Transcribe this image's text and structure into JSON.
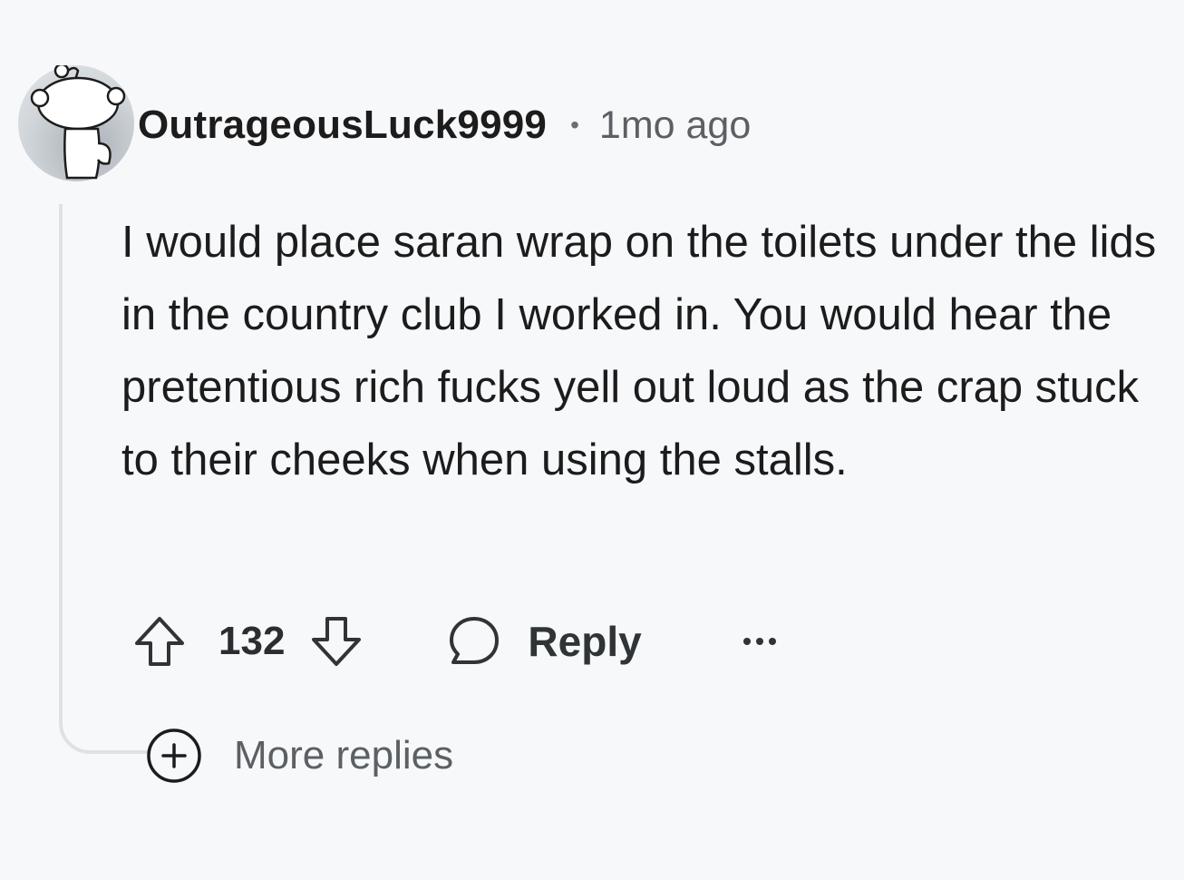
{
  "comment": {
    "username": "OutrageousLuck9999",
    "separator": "•",
    "timestamp": "1mo ago",
    "body": "I would place saran wrap on the toilets under the lids in the country club I worked in. You would hear the pretentious rich fucks yell out loud as the crap stuck to their cheeks when using the stalls.",
    "vote_count": "132",
    "reply_label": "Reply",
    "more_replies_label": "More replies"
  },
  "icons": {
    "avatar": "snoo-avatar-icon",
    "upvote": "arrow-up-icon",
    "downvote": "arrow-down-icon",
    "reply": "chat-bubble-icon",
    "more": "ellipsis-icon",
    "expand": "plus-circle-icon"
  },
  "colors": {
    "background": "#f7f8fa",
    "text_primary": "#1c1c1c",
    "text_secondary": "#5b6064",
    "thread_line": "#dfe2e5"
  }
}
